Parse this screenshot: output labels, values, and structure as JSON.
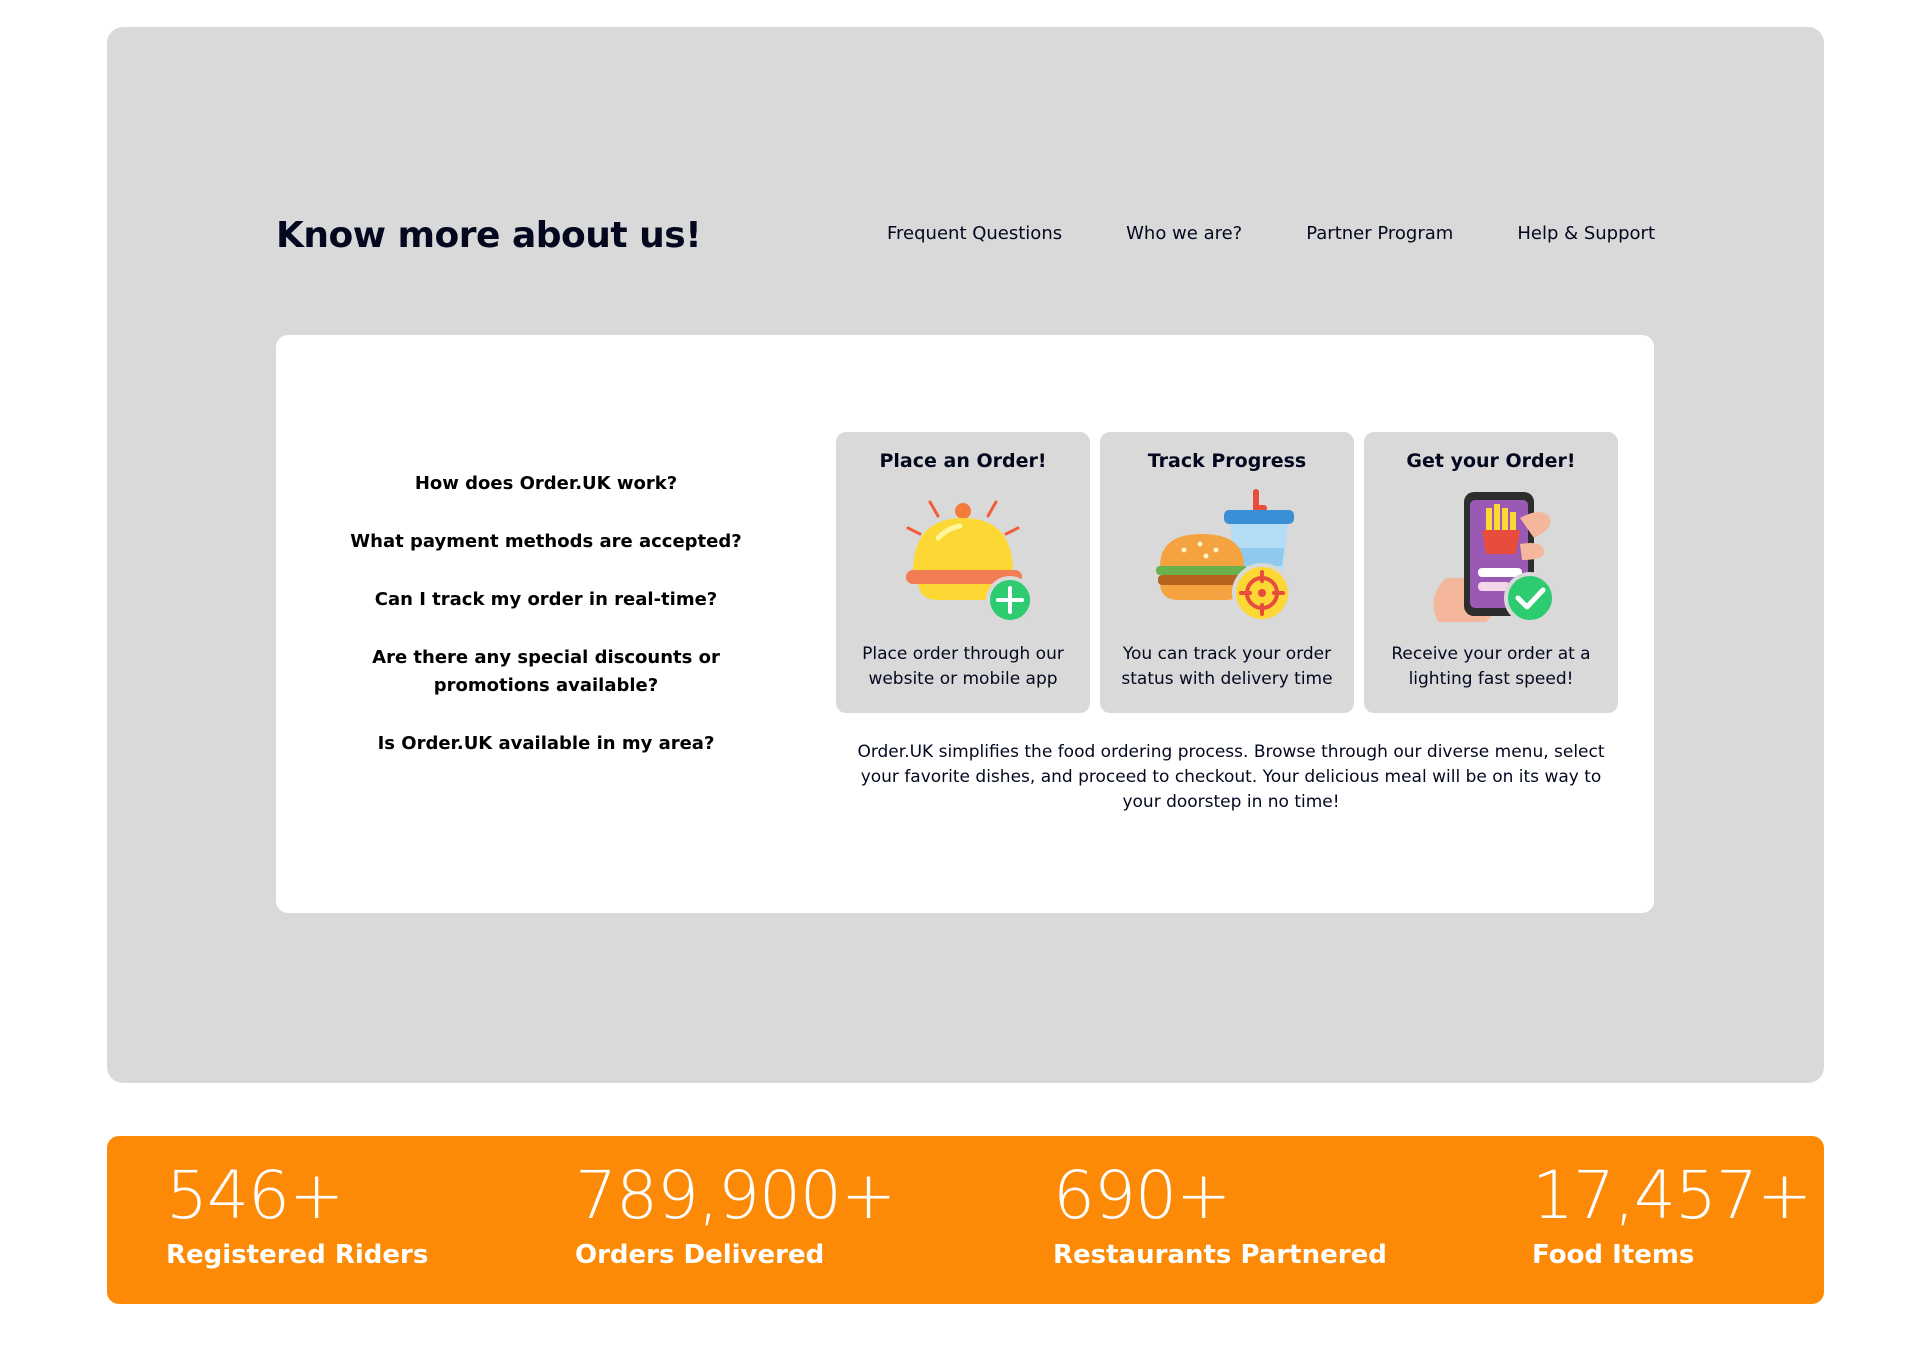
{
  "about": {
    "title": "Know more about us!",
    "nav": [
      "Frequent Questions",
      "Who we are?",
      "Partner Program",
      "Help & Support"
    ]
  },
  "faq": [
    "How does Order.UK work?",
    "What payment methods are accepted?",
    "Can I track my order in real-time?",
    "Are there any special discounts or promotions available?",
    "Is Order.UK available in my area?"
  ],
  "steps": [
    {
      "title": "Place an Order!",
      "description": "Place order through our website or mobile app",
      "icon": "food-cloche-add-icon"
    },
    {
      "title": "Track Progress",
      "description": "You can track your order status with delivery time",
      "icon": "burger-drink-tracking-icon"
    },
    {
      "title": "Get your Order!",
      "description": "Receive your order at a lighting fast speed!",
      "icon": "phone-fries-check-icon"
    }
  ],
  "summary": "Order.UK simplifies the food ordering process. Browse through our diverse menu, select your favorite dishes, and proceed to checkout. Your delicious meal will be on its way to your doorstep in no time!",
  "stats": [
    {
      "value": "546+",
      "label": "Registered Riders"
    },
    {
      "value": "789,900+",
      "label": "Orders Delivered"
    },
    {
      "value": "690+",
      "label": "Restaurants Partnered"
    },
    {
      "value": "17,457+",
      "label": "Food Items"
    }
  ],
  "colors": {
    "panel": "#d9d9d9",
    "card": "#ffffff",
    "accent": "#fc8a06",
    "text": "#03081f"
  }
}
